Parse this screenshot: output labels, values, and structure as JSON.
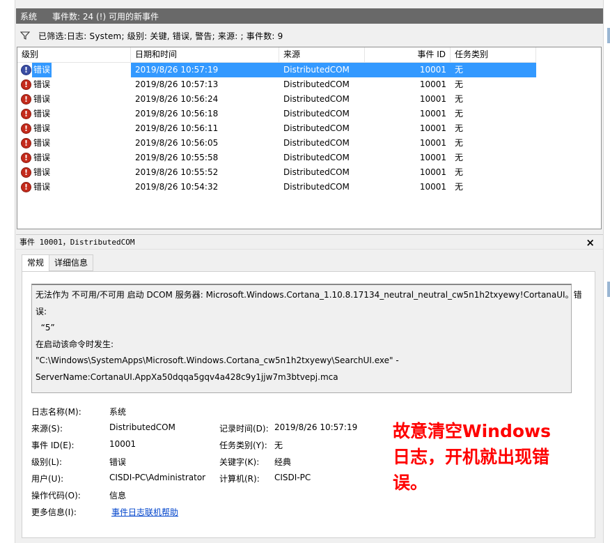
{
  "header": {
    "title": "系统",
    "count_text": "事件数: 24 (!) 可用的新事件"
  },
  "filter": {
    "icon": "filter-icon",
    "text": "已筛选:日志: System; 级别: 关键, 错误, 警告; 来源: ; 事件数: 9"
  },
  "grid": {
    "columns": [
      "级别",
      "日期和时间",
      "来源",
      "事件 ID",
      "任务类别"
    ],
    "rows": [
      {
        "level": "错误",
        "date": "2019/8/26 10:57:19",
        "source": "DistributedCOM",
        "id": "10001",
        "task": "无"
      },
      {
        "level": "错误",
        "date": "2019/8/26 10:57:13",
        "source": "DistributedCOM",
        "id": "10001",
        "task": "无"
      },
      {
        "level": "错误",
        "date": "2019/8/26 10:56:24",
        "source": "DistributedCOM",
        "id": "10001",
        "task": "无"
      },
      {
        "level": "错误",
        "date": "2019/8/26 10:56:18",
        "source": "DistributedCOM",
        "id": "10001",
        "task": "无"
      },
      {
        "level": "错误",
        "date": "2019/8/26 10:56:11",
        "source": "DistributedCOM",
        "id": "10001",
        "task": "无"
      },
      {
        "level": "错误",
        "date": "2019/8/26 10:56:05",
        "source": "DistributedCOM",
        "id": "10001",
        "task": "无"
      },
      {
        "level": "错误",
        "date": "2019/8/26 10:55:58",
        "source": "DistributedCOM",
        "id": "10001",
        "task": "无"
      },
      {
        "level": "错误",
        "date": "2019/8/26 10:55:52",
        "source": "DistributedCOM",
        "id": "10001",
        "task": "无"
      },
      {
        "level": "错误",
        "date": "2019/8/26 10:54:32",
        "source": "DistributedCOM",
        "id": "10001",
        "task": "无"
      }
    ],
    "selected_index": 0
  },
  "detail": {
    "title": "事件 10001，DistributedCOM",
    "close_label": "×",
    "tabs": [
      "常规",
      "详细信息"
    ],
    "active_tab": 0,
    "description_lines": [
      "无法作为 不可用/不可用 启动 DCOM 服务器: Microsoft.Windows.Cortana_1.10.8.17134_neutral_neutral_cw5n1h2txyewy!CortanaUI。错",
      "误:",
      "  “5”",
      "在启动该命令时发生:",
      "\"C:\\Windows\\SystemApps\\Microsoft.Windows.Cortana_cw5n1h2txyewy\\SearchUI.exe\" -",
      "ServerName:CortanaUI.AppXa50dqqa5gqv4a428c9y1jjw7m3btvepj.mca"
    ],
    "fields": {
      "log_name_label": "日志名称(M):",
      "log_name": "系统",
      "source_label": "来源(S):",
      "source": "DistributedCOM",
      "logged_label": "记录时间(D):",
      "logged": "2019/8/26 10:57:19",
      "event_id_label": "事件 ID(E):",
      "event_id": "10001",
      "task_label": "任务类别(Y):",
      "task": "无",
      "level_label": "级别(L):",
      "level": "错误",
      "keywords_label": "关键字(K):",
      "keywords": "经典",
      "user_label": "用户(U):",
      "user": "CISDI-PC\\Administrator",
      "computer_label": "计算机(R):",
      "computer": "CISDI-PC",
      "opcode_label": "操作代码(O):",
      "opcode": "信息",
      "more_info_label": "更多信息(I):",
      "more_info_link": "事件日志联机帮助"
    }
  },
  "annotation": {
    "lines": [
      "故意清空Windows",
      "日志，开机就出现错",
      "误。"
    ],
    "color": "#ff0000"
  },
  "colors": {
    "selected": "#3399ff",
    "header_bg": "#696969",
    "error_icon": "#c42b1c"
  }
}
